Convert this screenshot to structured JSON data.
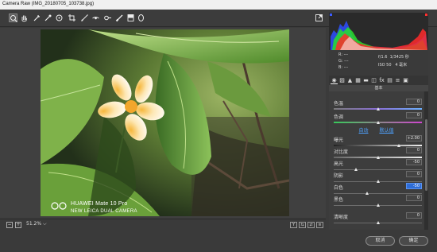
{
  "window": {
    "title": "Camera Raw (IMG_20180705_103738.jpg)"
  },
  "toolbar": {
    "tools": [
      {
        "name": "zoom-tool"
      },
      {
        "name": "hand-tool"
      },
      {
        "name": "white-balance-tool"
      },
      {
        "name": "color-sampler-tool"
      },
      {
        "name": "targeted-adjustment-tool"
      },
      {
        "name": "crop-tool"
      },
      {
        "name": "straighten-tool"
      },
      {
        "name": "spot-removal-tool"
      },
      {
        "name": "red-eye-tool"
      },
      {
        "name": "adjustment-brush-tool"
      },
      {
        "name": "graduated-filter-tool"
      },
      {
        "name": "radial-filter-tool"
      },
      {
        "name": "fullscreen-toggle"
      }
    ]
  },
  "photo": {
    "watermark_line1": "HUAWEI Mate 10 Pro",
    "watermark_line2": "NEW LEICA DUAL CAMERA"
  },
  "statusbar": {
    "zoom": "51.2%",
    "zoom_dropdown": "⌵",
    "view_before_after": "Y",
    "swap": "⇆",
    "copy": "⇄",
    "settings": "≡"
  },
  "readout": {
    "r": "R:",
    "g": "G:",
    "b": "B:",
    "r_val": "---",
    "g_val": "---",
    "b_val": "---",
    "aperture": "f/1.6",
    "shutter": "1/3425 秒",
    "iso": "ISO 50",
    "focal": "4 毫米"
  },
  "panel": {
    "header": "基本",
    "auto_link": "自动",
    "default_link": "默认值",
    "rows": [
      {
        "label": "色温",
        "value": "0",
        "level": 0.5
      },
      {
        "label": "色调",
        "value": "0",
        "level": 0.5
      },
      {
        "label": "曝光",
        "value": "+2.00",
        "level": 0.74
      },
      {
        "label": "对比度",
        "value": "0",
        "level": 0.5
      },
      {
        "label": "高光",
        "value": "-50",
        "level": 0.25
      },
      {
        "label": "阴影",
        "value": "0",
        "level": 0.5
      },
      {
        "label": "白色",
        "value": "-50",
        "level": 0.38
      },
      {
        "label": "黑色",
        "value": "0",
        "level": 0.5
      },
      {
        "label": "清晰度",
        "value": "0",
        "level": 0.5
      }
    ]
  },
  "buttons": {
    "cancel": "取消",
    "ok": "确定"
  },
  "colors": {
    "accent": "#2e6dd7",
    "link": "#4ea2ff"
  }
}
